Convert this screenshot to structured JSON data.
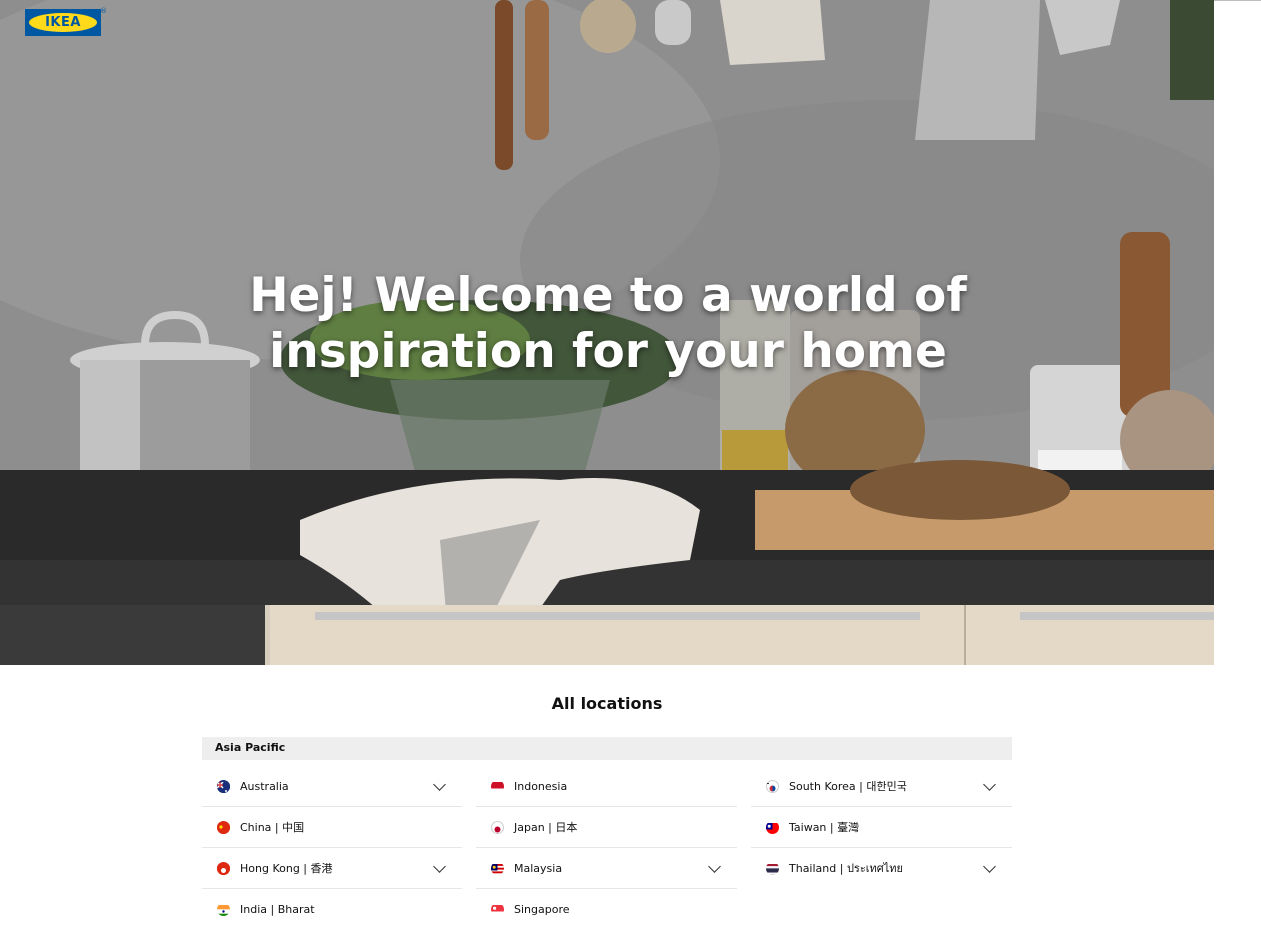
{
  "brand": {
    "logo_text": "IKEA"
  },
  "hero": {
    "headline": "Hej! Welcome to a world of inspiration for your home"
  },
  "locations": {
    "title": "All locations",
    "region": "Asia Pacific",
    "columns": [
      [
        {
          "label": "Australia",
          "flag": "australia-flag-icon",
          "expandable": true
        },
        {
          "label": "China | 中国",
          "flag": "china-flag-icon",
          "expandable": false
        },
        {
          "label": "Hong Kong | 香港",
          "flag": "hong-kong-flag-icon",
          "expandable": true
        },
        {
          "label": "India | Bharat",
          "flag": "india-flag-icon",
          "expandable": false
        }
      ],
      [
        {
          "label": "Indonesia",
          "flag": "indonesia-flag-icon",
          "expandable": false
        },
        {
          "label": "Japan | 日本",
          "flag": "japan-flag-icon",
          "expandable": false
        },
        {
          "label": "Malaysia",
          "flag": "malaysia-flag-icon",
          "expandable": true
        },
        {
          "label": "Singapore",
          "flag": "singapore-flag-icon",
          "expandable": false
        }
      ],
      [
        {
          "label": "South Korea | 대한민국",
          "flag": "south-korea-flag-icon",
          "expandable": true
        },
        {
          "label": "Taiwan | 臺灣",
          "flag": "taiwan-flag-icon",
          "expandable": false
        },
        {
          "label": "Thailand | ประเทศไทย",
          "flag": "thailand-flag-icon",
          "expandable": true
        }
      ]
    ]
  },
  "colors": {
    "ikea_blue": "#0058a3",
    "ikea_yellow": "#ffda1a",
    "region_bar": "#eeeeee"
  }
}
